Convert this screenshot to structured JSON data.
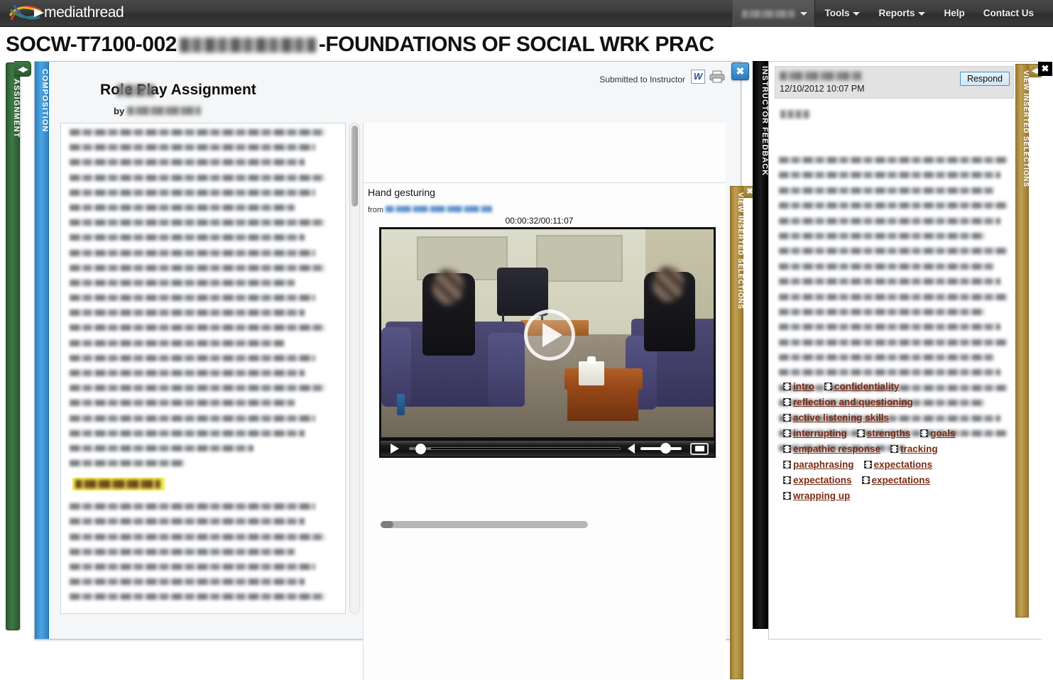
{
  "topnav": {
    "brand": "mediathread",
    "user_label": "",
    "items": [
      {
        "label": "Tools",
        "has_caret": true
      },
      {
        "label": "Reports",
        "has_caret": true
      },
      {
        "label": "Help",
        "has_caret": false
      },
      {
        "label": "Contact Us",
        "has_caret": false
      }
    ]
  },
  "course": {
    "code": "SOCW-T7100-002",
    "name_redacted": "",
    "title_suffix": "-FOUNDATIONS OF SOCIAL WRK PRAC"
  },
  "left_tab": {
    "label": "ASSIGNMENT",
    "arrow_icon": "left-right-arrow-icon"
  },
  "composition": {
    "tab_label": "COMPOSITION",
    "title": "Role Play Assignment",
    "title_prefix_redacted": "",
    "by_label": "by",
    "author_redacted": "",
    "status": "Submitted to Instructor",
    "word_icon_glyph": "W",
    "word_icon_name": "word-export-icon",
    "print_icon_name": "print-icon",
    "close_label": "✖",
    "annotation_chip_label": "Hand gesturing"
  },
  "video": {
    "title": "Hand gesturing",
    "from_label": "from",
    "source_redacted": "",
    "timecode": "00:00:32/00:11:07",
    "play_button_name": "play-button",
    "controls": {
      "play_label": "Play",
      "volume_label": "Volume",
      "fullscreen_label": "Fullscreen"
    }
  },
  "gold_tab_inner": {
    "label": "VIEW INSERTED SELECTIONS",
    "close_label": "✖"
  },
  "feedback": {
    "tab_label": "INSTRUCTOR FEEDBACK",
    "author_redacted": "",
    "date": "12/10/2012 10:07 PM",
    "respond_label": "Respond",
    "links": [
      "intro",
      "confidentiality",
      "reflection and questioning",
      "active listening skills",
      "interrupting",
      "strengths",
      "goals",
      "empathic response",
      "tracking",
      "paraphrasing",
      "expectations",
      "expectations",
      "expectations",
      "wrapping up"
    ]
  },
  "gold_tab_right": {
    "label": "VIEW INSERTED SELECTIONS",
    "arrow_icon": "left-right-arrow-icon"
  },
  "right_close": {
    "label": "✖"
  },
  "colors": {
    "nav_bg": "#3a3a3a",
    "assignment_green": "#3d7a42",
    "composition_blue": "#2d85c6",
    "gold": "#a8862f",
    "feedback_black": "#000000",
    "link_maroon": "#7a2b14",
    "highlight_yellow": "#f5ef57"
  }
}
